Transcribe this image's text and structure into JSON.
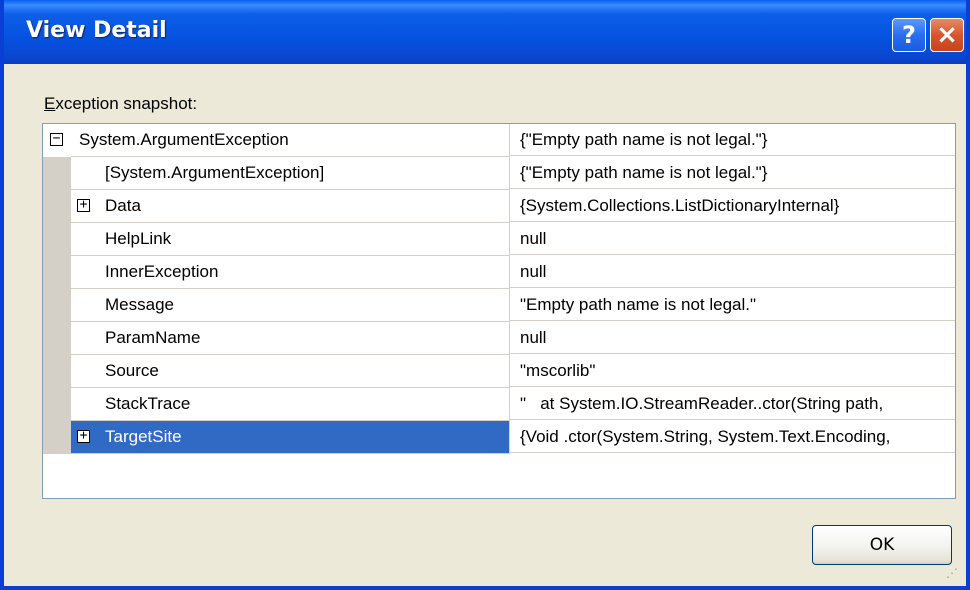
{
  "window": {
    "title": "View Detail",
    "help_label": "?",
    "close_label": "×"
  },
  "section_label": {
    "accel": "E",
    "rest": "xception snapshot:"
  },
  "rows": [
    {
      "name": "System.ArgumentException",
      "value": "{\"Empty path name is not legal.\"}",
      "expander": "−"
    },
    {
      "name": "[System.ArgumentException]",
      "value": "{\"Empty path name is not legal.\"}",
      "expander": ""
    },
    {
      "name": "Data",
      "value": "{System.Collections.ListDictionaryInternal}",
      "expander": "+"
    },
    {
      "name": "HelpLink",
      "value": "null",
      "expander": ""
    },
    {
      "name": "InnerException",
      "value": "null",
      "expander": ""
    },
    {
      "name": "Message",
      "value": "\"Empty path name is not legal.\"",
      "expander": ""
    },
    {
      "name": "ParamName",
      "value": "null",
      "expander": ""
    },
    {
      "name": "Source",
      "value": "\"mscorlib\"",
      "expander": ""
    },
    {
      "name": "StackTrace",
      "value": "\"   at System.IO.StreamReader..ctor(String path,",
      "expander": ""
    },
    {
      "name": "TargetSite",
      "value": "{Void .ctor(System.String, System.Text.Encoding,",
      "expander": "+"
    }
  ],
  "ok_button": {
    "label": "OK"
  },
  "colors": {
    "titlebar": "#0552e0",
    "selection": "#316ac5",
    "dialog_bg": "#ece9d8"
  }
}
